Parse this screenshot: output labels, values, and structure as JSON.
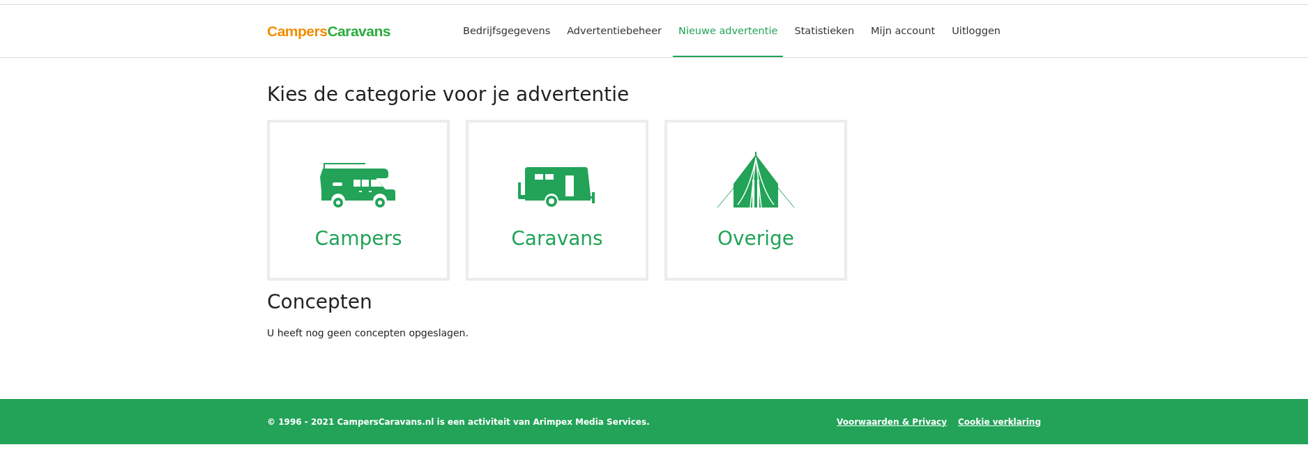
{
  "header": {
    "logo": [
      "Campers",
      "Caravans"
    ],
    "nav": [
      {
        "label": "Bedrijfsgegevens",
        "selected": false
      },
      {
        "label": "Advertentiebeheer",
        "selected": false
      },
      {
        "label": "Nieuwe advertentie",
        "selected": true
      },
      {
        "label": "Statistieken",
        "selected": false
      },
      {
        "label": "Mijn account",
        "selected": false
      },
      {
        "label": "Uitloggen",
        "selected": false
      }
    ]
  },
  "category_heading": "Kies de categorie voor je advertentie",
  "categories": [
    {
      "kind": "camper",
      "label": "Campers"
    },
    {
      "kind": "caravan",
      "label": "Caravans"
    },
    {
      "kind": "tent",
      "label": "Overige"
    }
  ],
  "drafts": {
    "heading": "Concepten",
    "message": "U heeft nog geen concepten opgeslagen."
  },
  "footer": {
    "copyright": "© 1996 - 2021 CampersCaravans.nl is een activiteit van Arimpex Media Services.",
    "links": [
      "Voorwaarden & Privacy",
      "Cookie verklaring"
    ]
  }
}
